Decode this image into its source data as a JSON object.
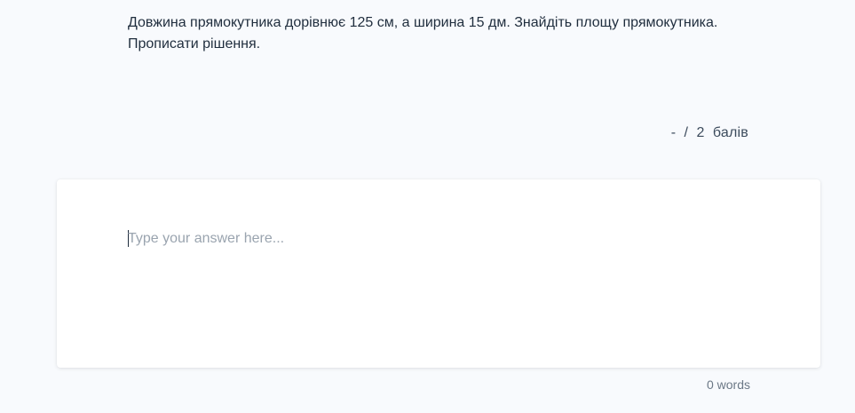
{
  "question": {
    "line1": "Довжина прямокутника дорівнює 125 см, а ширина 15 дм. Знайдіть площу прямокутника.",
    "line2": "Прописати рішення."
  },
  "points": {
    "score": "-",
    "separator": "/",
    "max": "2",
    "unit": "балів"
  },
  "answer": {
    "value": "",
    "placeholder": "Type your answer here..."
  },
  "word_count": {
    "label": "0 words"
  }
}
